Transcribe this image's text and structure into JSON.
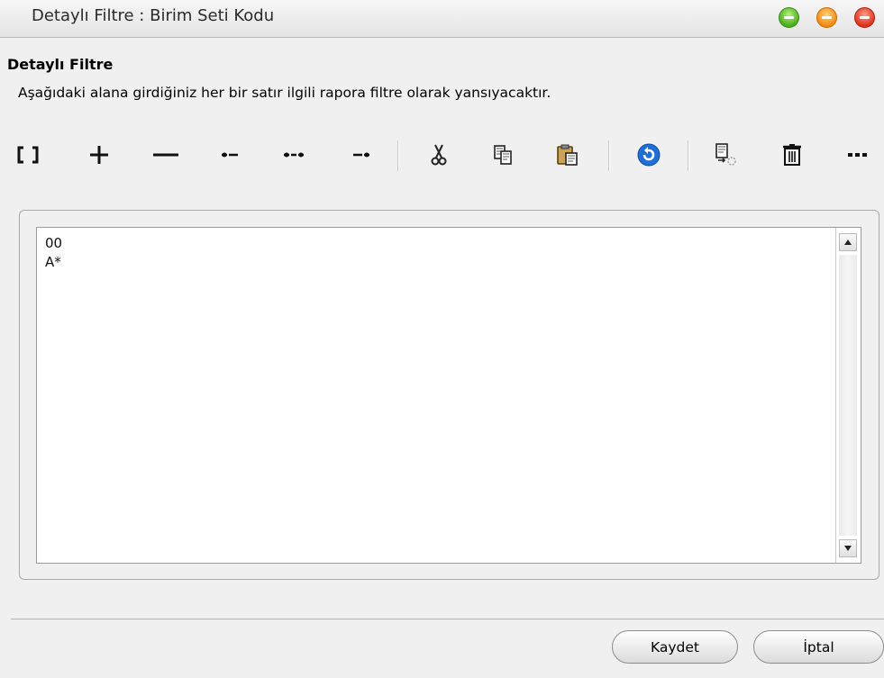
{
  "window": {
    "title": "Detaylı Filtre : Birim Seti Kodu",
    "buttons": [
      "green-icon",
      "orange-icon",
      "red-icon"
    ]
  },
  "header": {
    "heading": "Detaylı Filtre",
    "description": "Aşağıdaki alana girdiğiniz her bir satır ilgili rapora filtre olarak yansıyacaktır."
  },
  "toolbar": [
    {
      "name": "brackets-icon"
    },
    {
      "name": "plus-icon"
    },
    {
      "name": "minus-icon"
    },
    {
      "name": "dot-dash-icon"
    },
    {
      "name": "dot-dash-dot-icon"
    },
    {
      "name": "dash-dot-icon"
    },
    {
      "name": "cut-icon"
    },
    {
      "name": "copy-icon"
    },
    {
      "name": "paste-icon"
    },
    {
      "name": "undo-icon"
    },
    {
      "name": "document-export-icon"
    },
    {
      "name": "trash-icon"
    },
    {
      "name": "more-icon"
    }
  ],
  "filter_text": "00\nA*",
  "footer": {
    "save_label": "Kaydet",
    "cancel_label": "İptal"
  },
  "colors": {
    "accent": "#1f6fd6",
    "background": "#f0f0f0"
  }
}
